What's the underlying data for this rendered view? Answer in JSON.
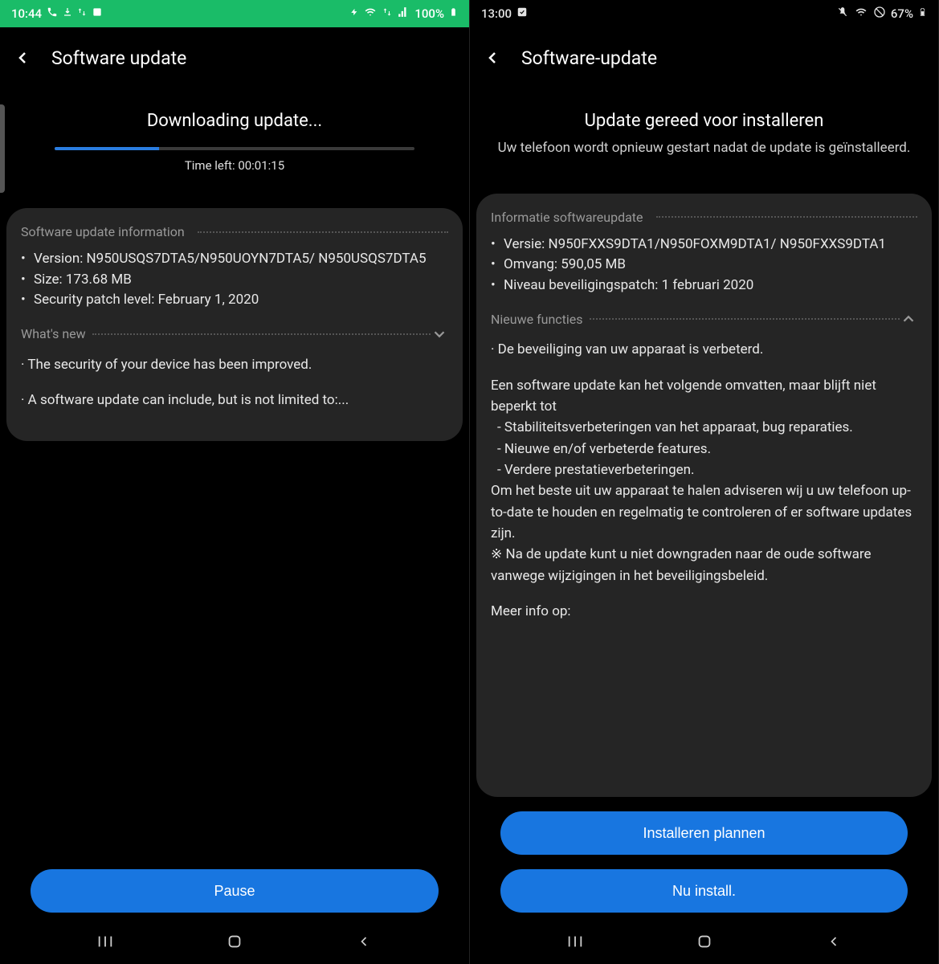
{
  "left": {
    "status": {
      "time": "10:44",
      "battery": "100%"
    },
    "header_title": "Software update",
    "downloading_title": "Downloading update...",
    "time_left": "Time left: 00:01:15",
    "info_header": "Software update information",
    "version_label": "Version: N950USQS7DTA5/N950UOYN7DTA5/ N950USQS7DTA5",
    "size_label": "Size: 173.68 MB",
    "patch_label": "Security patch level: February 1, 2020",
    "whatsnew": "What's new",
    "desc1": "· The security of your device has been improved.",
    "desc2": "· A software update can include, but is not limited to:...",
    "pause_btn": "Pause"
  },
  "right": {
    "status": {
      "time": "13:00",
      "battery": "67%"
    },
    "header_title": "Software-update",
    "ready_title": "Update gereed voor installeren",
    "ready_sub": "Uw telefoon wordt opnieuw gestart nadat de update is geïnstalleerd.",
    "info_header": "Informatie softwareupdate",
    "version_label": "Versie: N950FXXS9DTA1/N950FOXM9DTA1/ N950FXXS9DTA1",
    "size_label": "Omvang: 590,05 MB",
    "patch_label": "Niveau beveiligingspatch: 1 februari 2020",
    "whatsnew": "Nieuwe functies",
    "desc1": "· De beveiliging van uw apparaat is verbeterd.",
    "para1": "Een software update kan het volgende omvatten, maar blijft niet beperkt tot",
    "b1": " - Stabiliteitsverbeteringen van het apparaat, bug reparaties.",
    "b2": " - Nieuwe en/of verbeterde features.",
    "b3": " - Verdere prestatieverbeteringen.",
    "para2": "Om het beste uit uw apparaat te halen adviseren wij u uw telefoon up-to-date te houden en regelmatig te controleren of er software updates zijn.",
    "para3": "※ Na de update kunt u niet downgraden naar de oude software vanwege wijzigingen in het beveiligingsbeleid.",
    "moreinfo": "Meer info op:",
    "schedule_btn": "Installeren plannen",
    "install_btn": "Nu install."
  }
}
